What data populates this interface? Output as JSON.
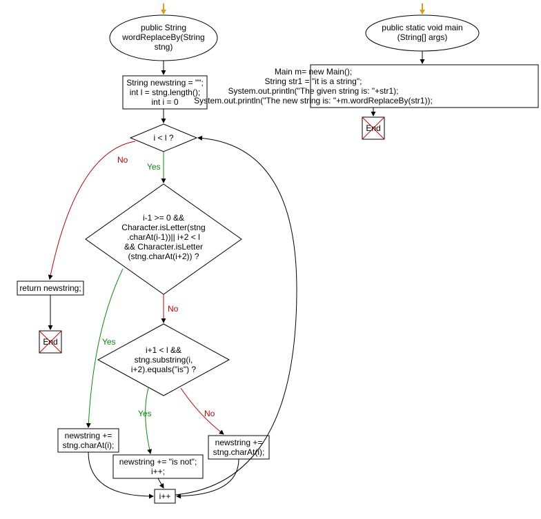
{
  "flowchart_left": {
    "start": {
      "line1": "public String",
      "line2": "wordReplaceBy(String",
      "line3": "stng)"
    },
    "init": {
      "line1": "String newstring = \"\";",
      "line2": "int l = stng.length();",
      "line3": "int i = 0"
    },
    "cond1": "i < l ?",
    "return": "return newstring;",
    "cond2": {
      "line1": "i-1 >= 0 &&",
      "line2": "Character.isLetter(stng",
      "line3": ".charAt(i-1))|| i+2 < l",
      "line4": "&& Character.isLetter",
      "line5": "(stng.charAt(i+2)) ?"
    },
    "cond3": {
      "line1": "i+1 < l &&",
      "line2": "stng.substring(i,",
      "line3": "i+2).equals(\"is\") ?"
    },
    "box_yes2": {
      "line1": "newstring +=",
      "line2": "stng.charAt(i);"
    },
    "box_yes3": {
      "line1": "newstring += \"is not\";",
      "line2": "i++;"
    },
    "box_no3": {
      "line1": "newstring +=",
      "line2": "stng.charAt(i);"
    },
    "incr": "i++",
    "end": "End"
  },
  "flowchart_right": {
    "start": {
      "line1": "public static void main",
      "line2": "(String[] args)"
    },
    "body": {
      "line1": "Main m= new Main();",
      "line2": "String str1 = \"it is a string\";",
      "line3": "System.out.println(\"The given string is: \"+str1);",
      "line4": "System.out.println(\"The new string is: \"+m.wordReplaceBy(str1));"
    },
    "end": "End"
  },
  "labels": {
    "yes": "Yes",
    "no": "No"
  },
  "colors": {
    "yes": "#0a8a0a",
    "no": "#c00000",
    "line": "#000000"
  }
}
